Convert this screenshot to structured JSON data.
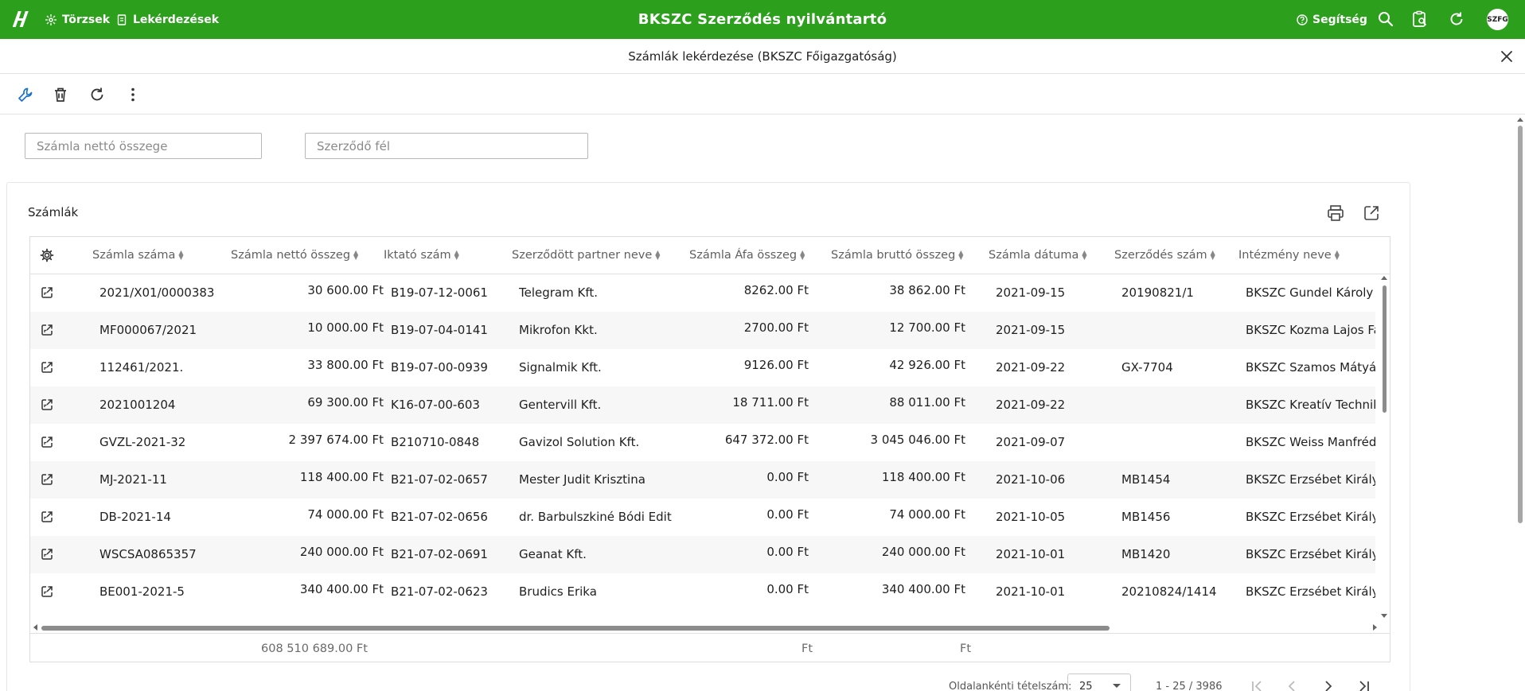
{
  "colors": {
    "brand": "#2ca01c",
    "row_alt": "#f7f7f7"
  },
  "topbar": {
    "logo_icon": "app-logo-icon",
    "nav": [
      {
        "label": "Törzsek",
        "icon": "sparkle-icon"
      },
      {
        "label": "Lekérdezések",
        "icon": "report-icon"
      }
    ],
    "app_title": "BKSZC Szerződés nyilvántartó",
    "help_label": "Segítség",
    "avatar_text": "SZFG"
  },
  "subheader": {
    "title": "Számlák lekérdezése (BKSZC Főigazgatóság)"
  },
  "filters": {
    "net_amount_placeholder": "Számla nettó összege",
    "party_placeholder": "Szerződő fél"
  },
  "card": {
    "title": "Számlák"
  },
  "table": {
    "columns": [
      "Számla száma",
      "Számla nettó összeg",
      "Iktató szám",
      "Szerződött partner neve",
      "Számla Áfa összeg",
      "Számla bruttó összeg",
      "Számla dátuma",
      "Szerződés szám",
      "Intézmény neve"
    ],
    "rows": [
      {
        "invoice_no": "2021/X01/0000383",
        "net": "30 600.00 Ft",
        "filing_no": "B19-07-12-0061",
        "partner": "Telegram Kft.",
        "vat": "8262.00 Ft",
        "gross": "38 862.00 Ft",
        "date": "2021-09-15",
        "contract_no": "20190821/1",
        "institution": "BKSZC Gundel Károly Vendéglátó"
      },
      {
        "invoice_no": "MF000067/2021",
        "net": "10 000.00 Ft",
        "filing_no": "B19-07-04-0141",
        "partner": "Mikrofon Kkt.",
        "vat": "2700.00 Ft",
        "gross": "12 700.00 Ft",
        "date": "2021-09-15",
        "contract_no": "",
        "institution": "BKSZC Kozma Lajos Faipari"
      },
      {
        "invoice_no": "112461/2021.",
        "net": "33 800.00 Ft",
        "filing_no": "B19-07-00-0939",
        "partner": "Signalmik Kft.",
        "vat": "9126.00 Ft",
        "gross": "42 926.00 Ft",
        "date": "2021-09-22",
        "contract_no": "GX-7704",
        "institution": "BKSZC Szamos Mátyás Technikum"
      },
      {
        "invoice_no": "2021001204",
        "net": "69 300.00 Ft",
        "filing_no": "K16-07-00-603",
        "partner": "Gentervill Kft.",
        "vat": "18 711.00 Ft",
        "gross": "88 011.00 Ft",
        "date": "2021-09-22",
        "contract_no": "",
        "institution": "BKSZC Kreatív Technikum"
      },
      {
        "invoice_no": "GVZL-2021-32",
        "net": "2 397 674.00 Ft",
        "filing_no": "B210710-0848",
        "partner": "Gavizol Solution Kft.",
        "vat": "647 372.00 Ft",
        "gross": "3 045 046.00 Ft",
        "date": "2021-09-07",
        "contract_no": "",
        "institution": "BKSZC Weiss Manfréd Technikum"
      },
      {
        "invoice_no": "MJ-2021-11",
        "net": "118 400.00 Ft",
        "filing_no": "B21-07-02-0657",
        "partner": "Mester Judit Krisztina",
        "vat": "0.00 Ft",
        "gross": "118 400.00 Ft",
        "date": "2021-10-06",
        "contract_no": "MB1454",
        "institution": "BKSZC Erzsébet Királyné Szépségipari"
      },
      {
        "invoice_no": "DB-2021-14",
        "net": "74 000.00 Ft",
        "filing_no": "B21-07-02-0656",
        "partner": "dr. Barbulszkiné Bódi Edit",
        "vat": "0.00 Ft",
        "gross": "74 000.00 Ft",
        "date": "2021-10-05",
        "contract_no": "MB1456",
        "institution": "BKSZC Erzsébet Királyné Szépségipari"
      },
      {
        "invoice_no": "WSCSA0865357",
        "net": "240 000.00 Ft",
        "filing_no": "B21-07-02-0691",
        "partner": "Geanat Kft.",
        "vat": "0.00 Ft",
        "gross": "240 000.00 Ft",
        "date": "2021-10-01",
        "contract_no": "MB1420",
        "institution": "BKSZC Erzsébet Királyné Szépségipari"
      },
      {
        "invoice_no": "BE001-2021-5",
        "net": "340 400.00 Ft",
        "filing_no": "B21-07-02-0623",
        "partner": "Brudics Erika",
        "vat": "0.00 Ft",
        "gross": "340 400.00 Ft",
        "date": "2021-10-01",
        "contract_no": "20210824/1414",
        "institution": "BKSZC Erzsébet Királyné Szépségipari"
      }
    ],
    "totals": {
      "net": "608 510 689.00 Ft",
      "vat": "Ft",
      "gross": "Ft"
    }
  },
  "pagination": {
    "per_page_label": "Oldalankénti tételszám:",
    "per_page_value": "25",
    "range": "1 - 25 / 3986"
  }
}
